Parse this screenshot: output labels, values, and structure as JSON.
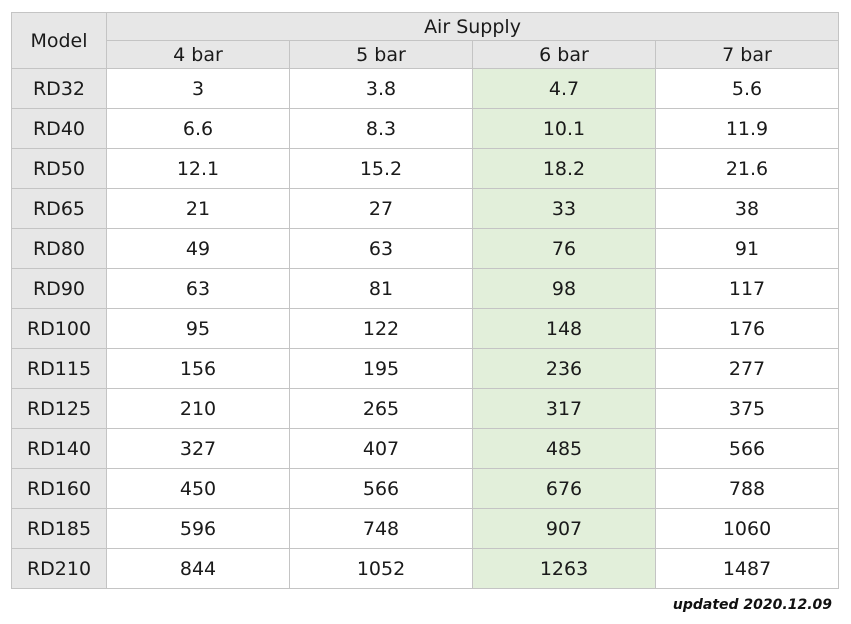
{
  "table": {
    "model_header": "Model",
    "group_header": "Air Supply",
    "pressure_headers": [
      "4 bar",
      "5 bar",
      "6 bar",
      "7 bar"
    ],
    "highlight_color": "#e2efda",
    "header_color": "#e7e7e7",
    "highlighted_column": "6 bar",
    "rows": [
      {
        "model": "RD32",
        "values": [
          "3",
          "3.8",
          "4.7",
          "5.6"
        ]
      },
      {
        "model": "RD40",
        "values": [
          "6.6",
          "8.3",
          "10.1",
          "11.9"
        ]
      },
      {
        "model": "RD50",
        "values": [
          "12.1",
          "15.2",
          "18.2",
          "21.6"
        ]
      },
      {
        "model": "RD65",
        "values": [
          "21",
          "27",
          "33",
          "38"
        ]
      },
      {
        "model": "RD80",
        "values": [
          "49",
          "63",
          "76",
          "91"
        ]
      },
      {
        "model": "RD90",
        "values": [
          "63",
          "81",
          "98",
          "117"
        ]
      },
      {
        "model": "RD100",
        "values": [
          "95",
          "122",
          "148",
          "176"
        ]
      },
      {
        "model": "RD115",
        "values": [
          "156",
          "195",
          "236",
          "277"
        ]
      },
      {
        "model": "RD125",
        "values": [
          "210",
          "265",
          "317",
          "375"
        ]
      },
      {
        "model": "RD140",
        "values": [
          "327",
          "407",
          "485",
          "566"
        ]
      },
      {
        "model": "RD160",
        "values": [
          "450",
          "566",
          "676",
          "788"
        ]
      },
      {
        "model": "RD185",
        "values": [
          "596",
          "748",
          "907",
          "1060"
        ]
      },
      {
        "model": "RD210",
        "values": [
          "844",
          "1052",
          "1263",
          "1487"
        ]
      }
    ]
  },
  "footer": {
    "note": "updated 2020.12.09"
  }
}
